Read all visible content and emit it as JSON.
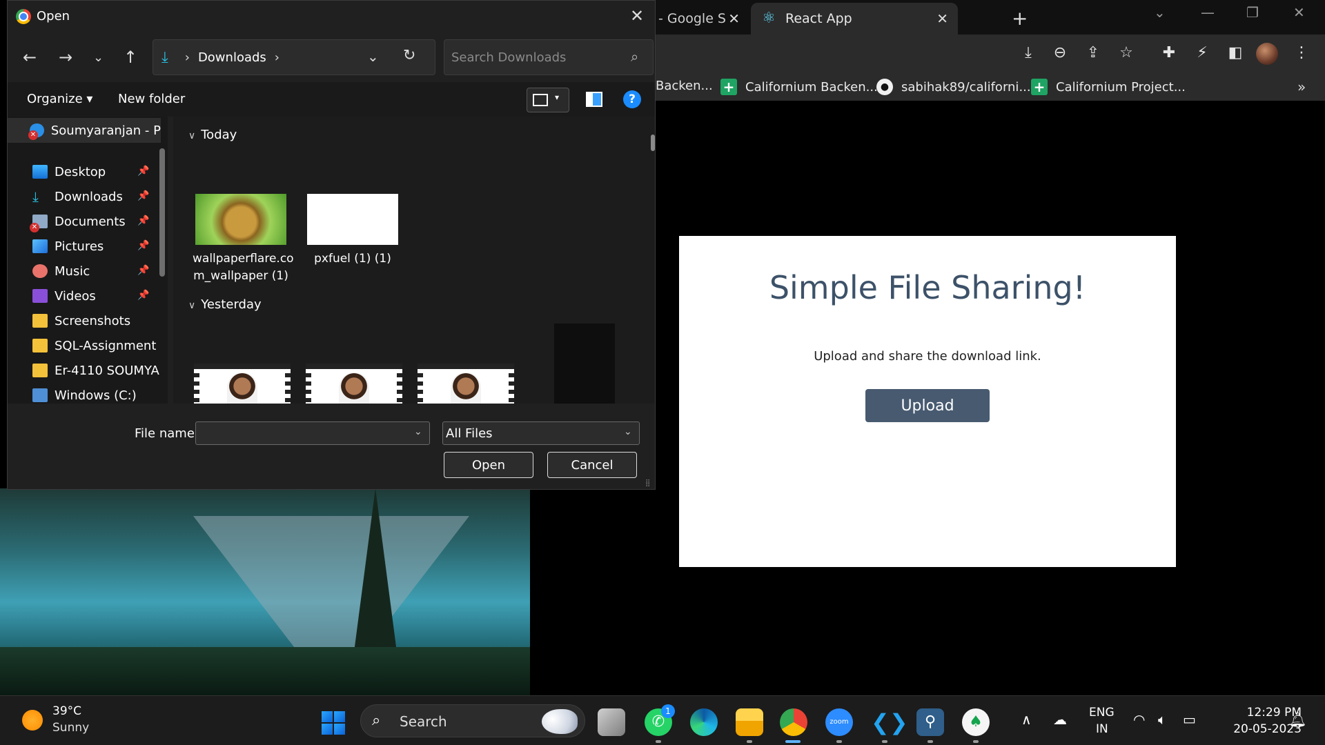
{
  "browser": {
    "tabs": [
      {
        "label": "- Google S"
      },
      {
        "label": "React App"
      }
    ],
    "new_tab": "+",
    "bookmarks": [
      {
        "label": "Backen..."
      },
      {
        "label": "Californium Backen..."
      },
      {
        "label": "sabihak89/californi..."
      },
      {
        "label": "Californium Project..."
      }
    ],
    "bookmarks_more": "»"
  },
  "page": {
    "title": "Simple File Sharing!",
    "subtitle": "Upload and share the download link.",
    "upload_label": "Upload"
  },
  "dialog": {
    "title": "Open",
    "address": {
      "location": "Downloads"
    },
    "search_placeholder": "Search Downloads",
    "commands": {
      "organize": "Organize ▾",
      "new_folder": "New folder"
    },
    "help": "?",
    "nav_items": [
      {
        "label": "Soumyaranjan - P"
      },
      {
        "label": "Desktop",
        "icon": "desktop-icon"
      },
      {
        "label": "Downloads",
        "icon": "downloads-icon"
      },
      {
        "label": "Documents",
        "icon": "documents-icon"
      },
      {
        "label": "Pictures",
        "icon": "pictures-icon"
      },
      {
        "label": "Music",
        "icon": "music-icon"
      },
      {
        "label": "Videos",
        "icon": "videos-icon"
      },
      {
        "label": "Screenshots",
        "icon": "folder-icon"
      },
      {
        "label": "SQL-Assignment",
        "icon": "folder-icon"
      },
      {
        "label": "Er-4110 SOUMYA",
        "icon": "folder-icon"
      },
      {
        "label": "Windows (C:)",
        "icon": "drive-icon"
      }
    ],
    "groups": [
      {
        "label": "Today"
      },
      {
        "label": "Yesterday"
      }
    ],
    "files_today": [
      {
        "name_line1": "wallpaperflare.co",
        "name_line2": "m_wallpaper (1)"
      },
      {
        "name_line1": "pxfuel (1) (1)"
      }
    ],
    "file_name_label": "File name:",
    "file_name_value": "",
    "file_type": "All Files",
    "open_label": "Open",
    "cancel_label": "Cancel"
  },
  "taskbar": {
    "weather": {
      "temp": "39°C",
      "condition": "Sunny"
    },
    "search_label": "Search",
    "whatsapp_badge": "1",
    "language": {
      "line1": "ENG",
      "line2": "IN"
    },
    "clock": {
      "time": "12:29 PM",
      "date": "20-05-2023"
    }
  },
  "colors": {
    "page_title": "#3d5269",
    "upload_button": "#475a70",
    "accent_blue": "#1a8cff"
  }
}
